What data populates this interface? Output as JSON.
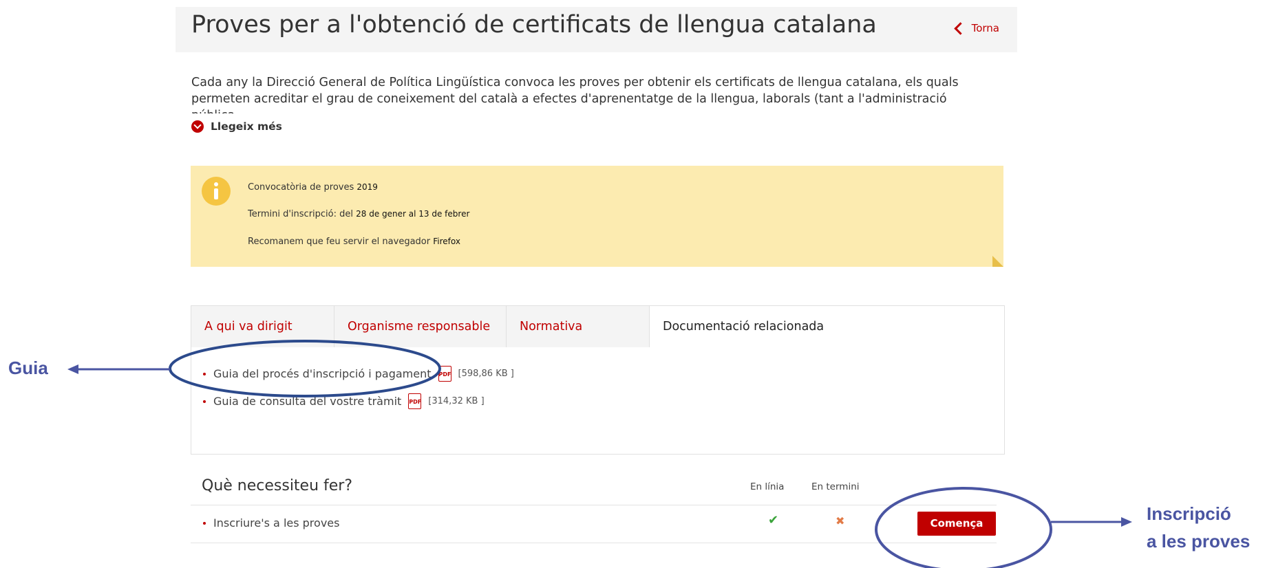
{
  "header": {
    "title": "Proves per a l'obtenció de certificats de llengua catalana",
    "back_label": "Torna"
  },
  "intro": {
    "text": "Cada any la Direcció General de Política Lingüística convoca les proves per obtenir els certificats de llengua catalana, els quals permeten acreditar el grau de coneixement del català a efectes d'aprenentatge de la llengua, laborals (tant a l'administració pública",
    "read_more": "Llegeix més"
  },
  "notice": {
    "line1_label": "Convocatòria de proves",
    "line1_value": "2019",
    "line2_label": "Termini d'inscripció: del",
    "line2_value": "28 de gener al 13 de febrer",
    "line3_label": "Recomanem que feu servir el  navegador",
    "line3_value": "Firefox",
    "colors": {
      "background": "#fcebb0",
      "icon": "#f5c542"
    }
  },
  "tabs": [
    {
      "label": "A qui va dirigit"
    },
    {
      "label": "Organisme responsable"
    },
    {
      "label": "Normativa"
    },
    {
      "label": "Documentació relacionada",
      "active": true
    }
  ],
  "documents": [
    {
      "label": "Guia del procés d'inscripció i pagament",
      "icon": "pdf-icon",
      "size": "[598,86 KB ]"
    },
    {
      "label": "Guia de consulta del vostre tràmit",
      "icon": "pdf-icon",
      "size": "[314,32 KB ]"
    }
  ],
  "actions": {
    "title": "Què necessiteu fer?",
    "col_online": "En línia",
    "col_term": "En termini",
    "rows": [
      {
        "label": "Inscriure's a les proves",
        "online": "✔",
        "in_term": "✖",
        "button": "Comença"
      }
    ]
  },
  "annotations": {
    "guide": "Guia",
    "signup_line1": "Inscripció",
    "signup_line2": "a les proves",
    "color": "#4a55a2"
  },
  "colors": {
    "accent": "#c00000"
  }
}
